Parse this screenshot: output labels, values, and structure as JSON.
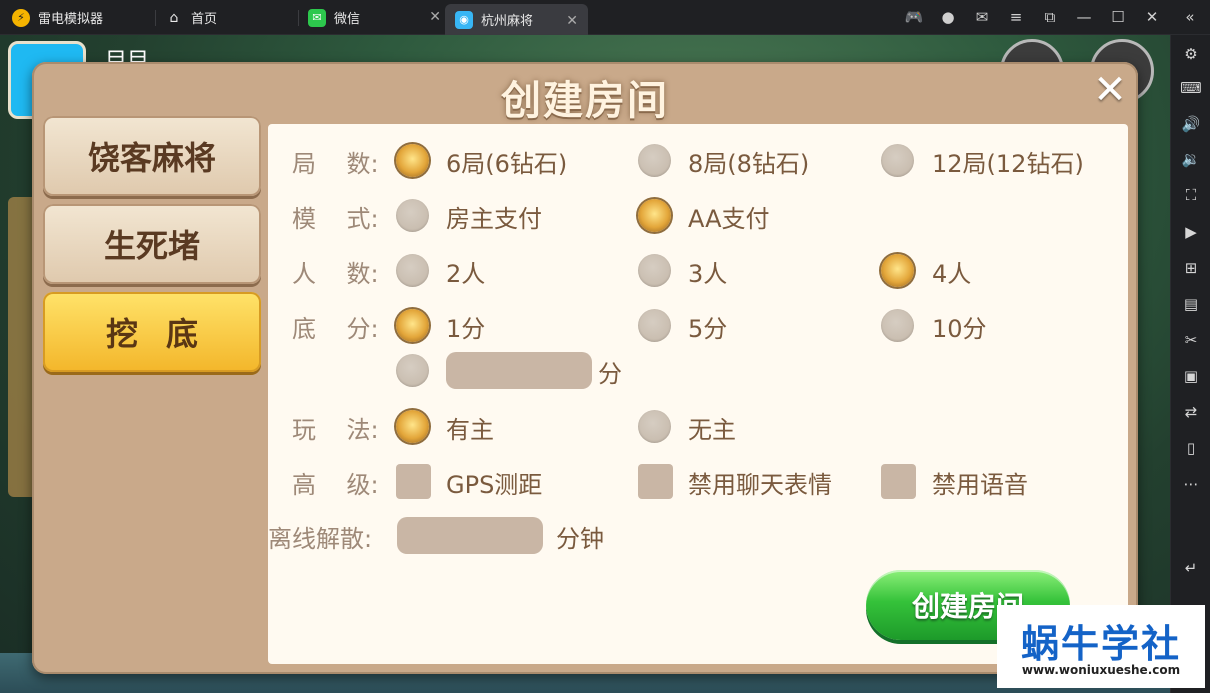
{
  "titlebar": {
    "app_name": "雷电模拟器",
    "tabs": [
      {
        "label": "首页"
      },
      {
        "label": "微信"
      },
      {
        "label": "杭州麻将"
      }
    ]
  },
  "game_bg": {
    "player_name": "目目"
  },
  "dialog": {
    "title": "创建房间",
    "close": "✕",
    "side_tabs": [
      "饶客麻将",
      "生死堵",
      "挖底"
    ],
    "rows": {
      "rounds": {
        "label": "局    数:",
        "options": [
          "6局(6钻石)",
          "8局(8钻石)",
          "12局(12钻石)"
        ],
        "selected": 0
      },
      "mode": {
        "label": "模    式:",
        "options": [
          "房主支付",
          "AA支付"
        ],
        "selected": 1
      },
      "players": {
        "label": "人    数:",
        "options": [
          "2人",
          "3人",
          "4人"
        ],
        "selected": 2
      },
      "base": {
        "label": "底    分:",
        "options": [
          "1分",
          "5分",
          "10分"
        ],
        "selected": 0,
        "custom_unit": "分"
      },
      "play": {
        "label": "玩    法:",
        "options": [
          "有主",
          "无主"
        ],
        "selected": 0
      },
      "advanced": {
        "label": "高    级:",
        "options": [
          "GPS测距",
          "禁用聊天表情",
          "禁用语音"
        ]
      },
      "offline": {
        "label": "离线解散:",
        "unit": "分钟"
      }
    },
    "create_button": "创建房间"
  },
  "watermark": {
    "text": "蜗牛学社",
    "url": "www.woniuxueshe.com"
  },
  "colors": {
    "dialog_bg": "#c9a98a",
    "panel_bg": "#fffaf1",
    "active_tab": "#f3b62a",
    "create_green": "#35c23a",
    "watermark_blue": "#1463c7"
  }
}
